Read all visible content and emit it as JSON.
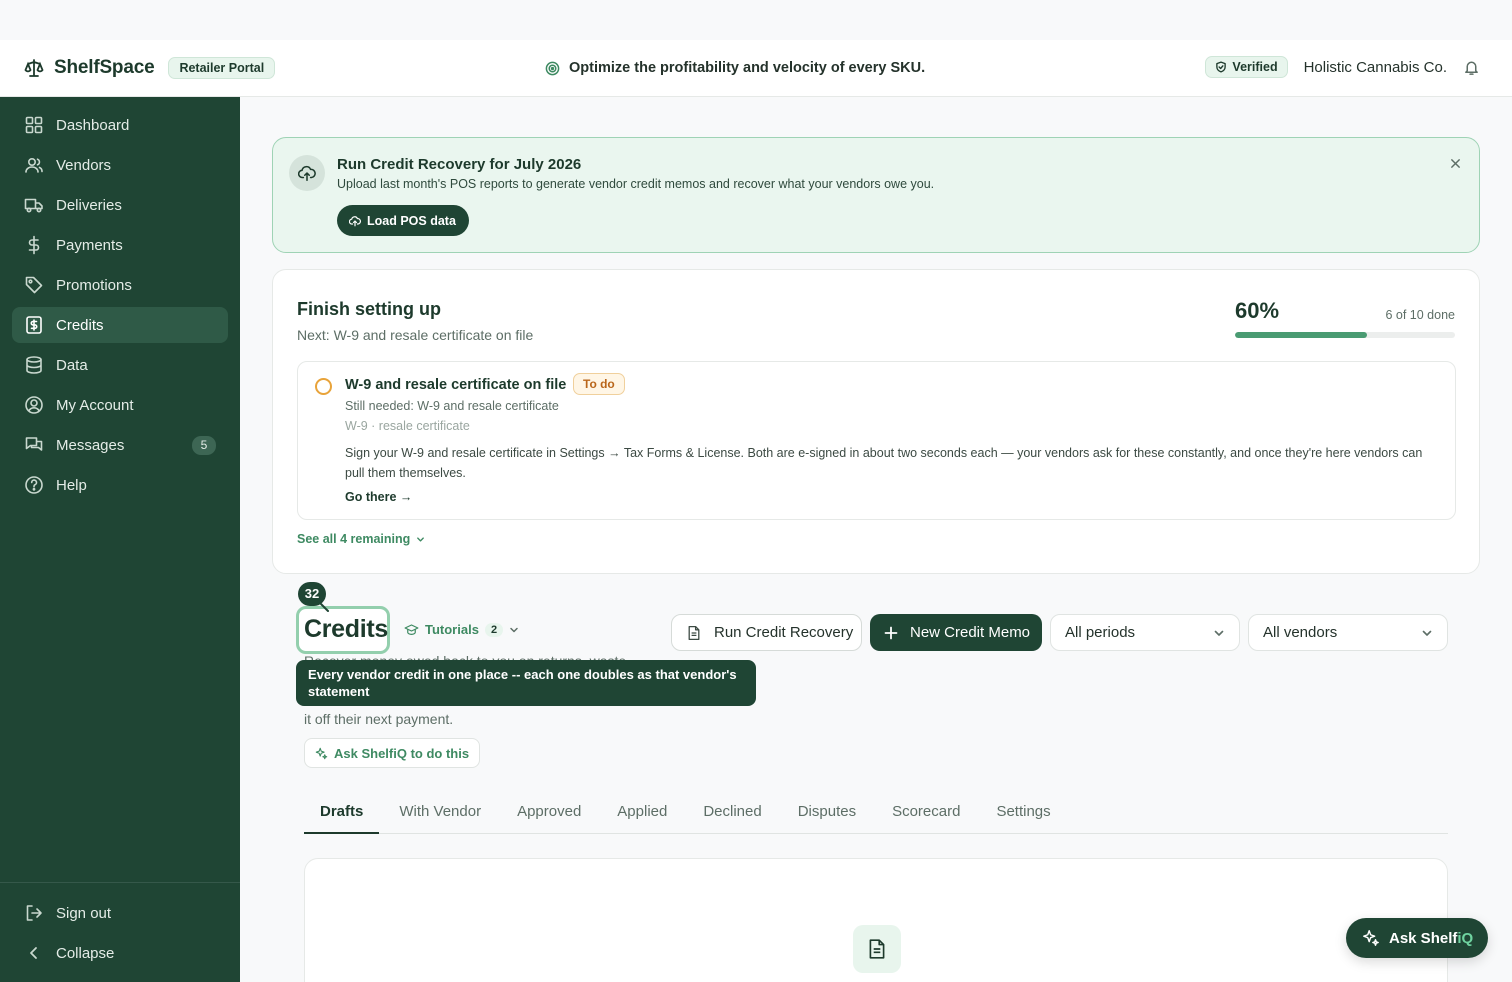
{
  "app": {
    "brand": "ShelfSpace",
    "portal_badge": "Retailer Portal",
    "tagline": "Optimize the profitability and velocity of every SKU.",
    "verified": "Verified",
    "company": "Holistic Cannabis Co."
  },
  "sidebar": {
    "items": [
      {
        "label": "Dashboard",
        "icon": "dashboard-icon"
      },
      {
        "label": "Vendors",
        "icon": "users-icon"
      },
      {
        "label": "Deliveries",
        "icon": "truck-icon"
      },
      {
        "label": "Payments",
        "icon": "dollar-icon"
      },
      {
        "label": "Promotions",
        "icon": "tag-icon"
      },
      {
        "label": "Credits",
        "icon": "receipt-icon",
        "active": true
      },
      {
        "label": "Data",
        "icon": "database-icon"
      },
      {
        "label": "My Account",
        "icon": "user-circle-icon"
      },
      {
        "label": "Messages",
        "icon": "chat-icon",
        "badge": "5"
      },
      {
        "label": "Help",
        "icon": "help-icon"
      }
    ],
    "sign_out": "Sign out",
    "collapse": "Collapse"
  },
  "banner": {
    "title": "Run Credit Recovery for July 2026",
    "subtitle": "Upload last month's POS reports to generate vendor credit memos and recover what your vendors owe you.",
    "button": "Load POS data"
  },
  "setup": {
    "title": "Finish setting up",
    "next": "Next: W-9 and resale certificate on file",
    "percent": "60%",
    "progress": 0.6,
    "done_count": "6 of 10 done",
    "task": {
      "title": "W-9 and resale certificate on file",
      "badge": "To do",
      "needed": "Still needed: W-9 and resale certificate",
      "meta": "W-9 · resale certificate",
      "description": "Sign your W-9 and resale certificate in Settings → Tax Forms & License. Both are e-signed in about two seconds each — your vendors ask for these constantly, and once they're here vendors can pull them themselves.",
      "link": "Go there →"
    },
    "see_all": "See all 4 remaining"
  },
  "credits": {
    "count": "32",
    "title": "Credits",
    "tutorials": "Tutorials",
    "tutorials_count": "2",
    "subtitle_line1": "Recover money owed back to you on returns, waste,",
    "subtitle_line3": "it off their next payment.",
    "tooltip": "Every vendor credit in one place -- each one doubles as that vendor's statement",
    "ask_link": "Ask ShelfiQ to do this",
    "run_recovery": "Run Credit Recovery",
    "new_memo": "New Credit Memo",
    "period_select": "All periods",
    "vendor_select": "All vendors",
    "tabs": [
      "Drafts",
      "With Vendor",
      "Approved",
      "Applied",
      "Declined",
      "Disputes",
      "Scorecard",
      "Settings"
    ],
    "active_tab": "Drafts"
  },
  "fab": {
    "label_a": "Ask Shelf",
    "label_b": "iQ"
  },
  "colors": {
    "sidebar": "#1f4534",
    "accent": "#3e8a62",
    "banner_bg": "#eaf6ef",
    "todo": "#e8a33a"
  }
}
